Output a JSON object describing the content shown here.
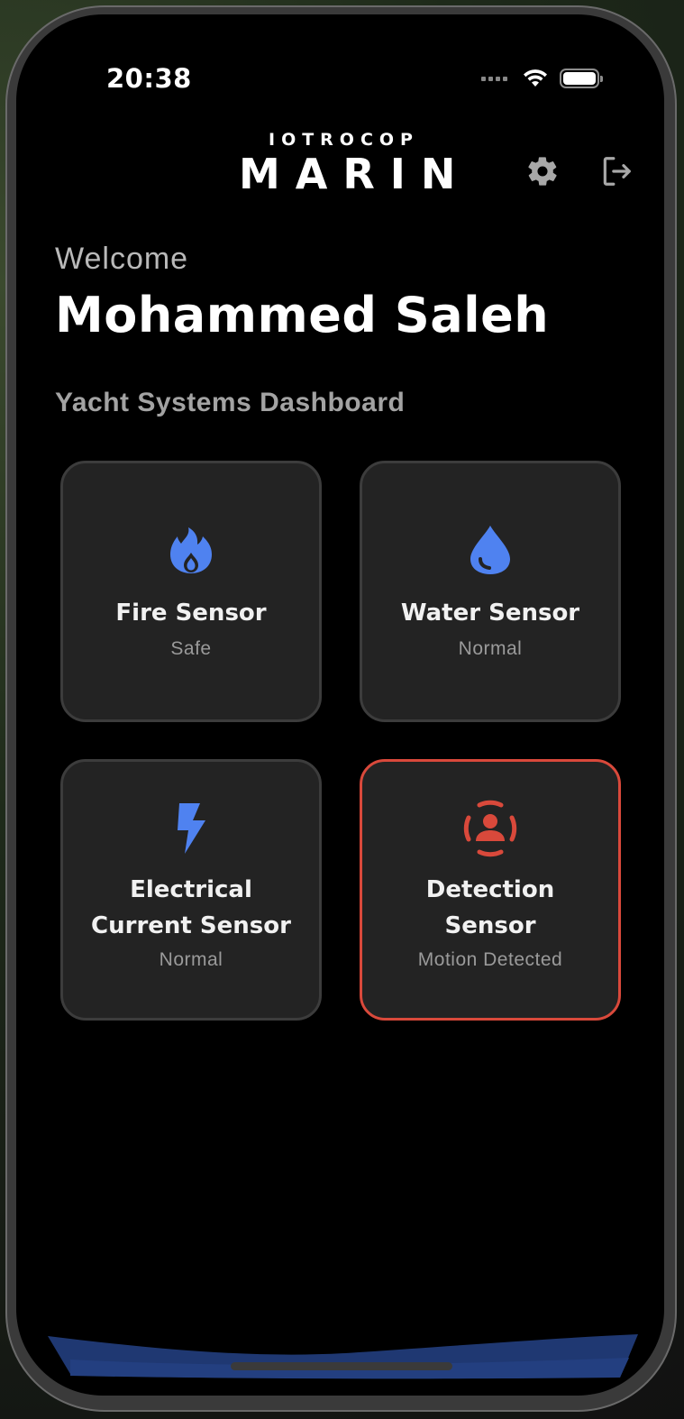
{
  "status_bar": {
    "time": "20:38"
  },
  "header": {
    "logo_top": "IOTROCOP",
    "logo_main": "MARIN",
    "settings_icon": "gear-icon",
    "logout_icon": "logout-icon"
  },
  "welcome": {
    "greeting": "Welcome",
    "name": "Mohammed Saleh"
  },
  "dashboard": {
    "title": "Yacht Systems Dashboard",
    "cards": [
      {
        "title": "Fire Sensor",
        "status": "Safe",
        "icon": "flame-icon",
        "color": "#4f82f0"
      },
      {
        "title": "Water Sensor",
        "status": "Normal",
        "icon": "water-drop-icon",
        "color": "#4f82f0"
      },
      {
        "title_line1": "Electrical",
        "title_line2": "Current Sensor",
        "status": "Normal",
        "icon": "lightning-icon",
        "color": "#4f82f0"
      },
      {
        "title_line1": "Detection",
        "title_line2": "Sensor",
        "status": "Motion Detected",
        "icon": "person-detect-icon",
        "color": "#d9493b"
      }
    ]
  },
  "colors": {
    "accent": "#4f82f0",
    "alert": "#d9493b",
    "card_bg": "#232323"
  }
}
